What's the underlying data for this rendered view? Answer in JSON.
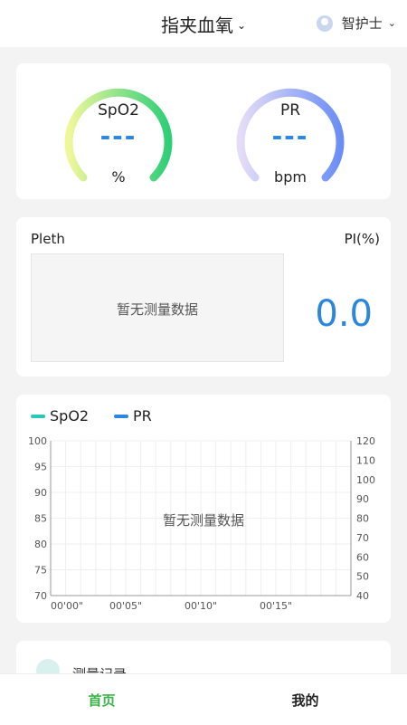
{
  "header": {
    "title": "指夹血氧",
    "user": "智护士"
  },
  "gauges": [
    {
      "label": "SpO2",
      "value": "---",
      "unit": "%",
      "color_start": "#f0f79b",
      "color_end": "#2fcf78"
    },
    {
      "label": "PR",
      "value": "---",
      "unit": "bpm",
      "color_start": "#e5dcf7",
      "color_end": "#6b8ef5"
    }
  ],
  "pleth": {
    "label": "Pleth",
    "pi_label": "PI(%)",
    "pi_value": "0.0",
    "empty": "暂无测量数据"
  },
  "trend": {
    "legend": [
      {
        "name": "SpO2",
        "color": "#2bc7b7"
      },
      {
        "name": "PR",
        "color": "#2a86de"
      }
    ],
    "y_left": [
      "100",
      "95",
      "90",
      "85",
      "80",
      "75",
      "70"
    ],
    "y_right": [
      "120",
      "110",
      "100",
      "90",
      "80",
      "70",
      "60",
      "50",
      "40"
    ],
    "x_ticks": [
      "00'00\"",
      "00'05\"",
      "00'10\"",
      "00'15\""
    ],
    "empty": "暂无测量数据"
  },
  "record": {
    "label": "测量记录"
  },
  "tabs": {
    "home": "首页",
    "mine": "我的"
  },
  "colors": {
    "accent_blue": "#2a86de",
    "tab_active": "#3bb34a"
  }
}
